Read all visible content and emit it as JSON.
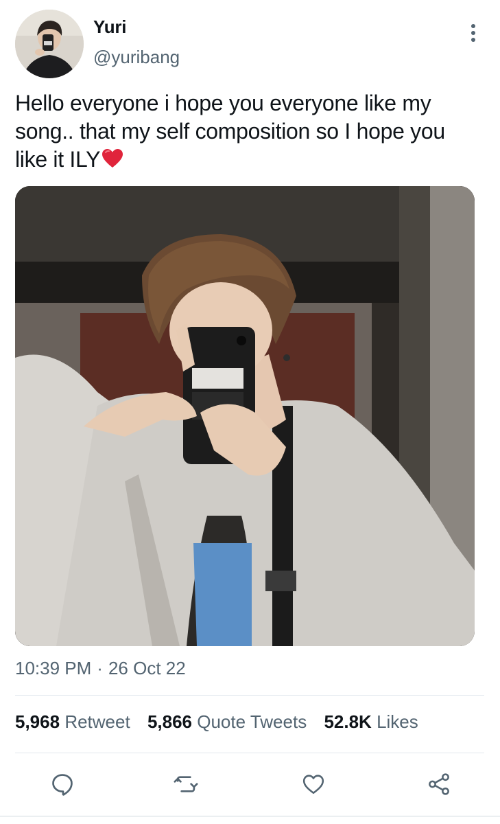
{
  "author": {
    "name": "Yuri",
    "handle": "@yuribang"
  },
  "tweet": {
    "text": "Hello everyone i hope you everyone like my song.. that my self composition so I hope you like it ILY",
    "emoji": "red-heart"
  },
  "meta": {
    "time": "10:39 PM",
    "separator": "·",
    "date": "26 Oct 22"
  },
  "stats": {
    "retweets": {
      "count": "5,968",
      "label": "Retweet"
    },
    "quotes": {
      "count": "5,866",
      "label": "Quote Tweets"
    },
    "likes": {
      "count": "52.8K",
      "label": "Likes"
    }
  },
  "actions": [
    "reply-icon",
    "retweet-icon",
    "like-icon",
    "share-icon"
  ],
  "colors": {
    "text": "#0f1419",
    "secondary": "#536471",
    "divider": "#e1e8ed",
    "heart": "#e0243b"
  }
}
